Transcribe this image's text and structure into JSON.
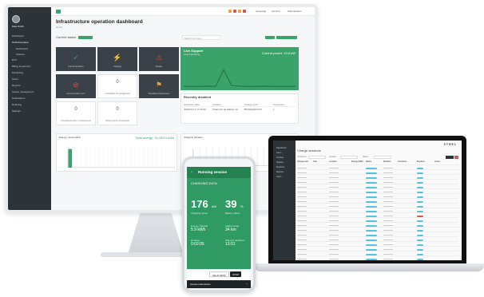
{
  "monitor": {
    "user_name": "Kate Smith",
    "sidebar": [
      {
        "label": "Dashboard",
        "active": false
      },
      {
        "label": "Technical plans",
        "active": true
      },
      {
        "label": "Dashboard",
        "sub": true
      },
      {
        "label": "Stations",
        "sub": true
      },
      {
        "label": "EVC",
        "active": false
      },
      {
        "label": "Billing & payment",
        "active": false
      },
      {
        "label": "Monitoring",
        "active": false
      },
      {
        "label": "Users",
        "active": false
      },
      {
        "label": "Reports",
        "active": false
      },
      {
        "label": "Assets management",
        "active": false
      },
      {
        "label": "Notifications",
        "active": false
      },
      {
        "label": "Roaming",
        "active": false
      },
      {
        "label": "Settings",
        "active": false
      }
    ],
    "topbar": {
      "language": "Language",
      "account": "Account",
      "role": "Administrator"
    },
    "title": "Infrastructure operation dashboard",
    "breadcrumb": "Home",
    "current_status_label": "Current status",
    "search_placeholder": "Search by name",
    "live_section_title": "Live Support",
    "live_subtitle": "Live monitoring",
    "live_value": "Current power: 13.8 kW",
    "recently_disabled_title": "Recently disabled",
    "table_headers": [
      "Activation date",
      "Location",
      "Charge point",
      "Connector"
    ],
    "table_row": [
      "2019-03-17 17:09:40",
      "Charmont de Mabrie inc",
      "BCG0Q1HS7C3",
      "1"
    ],
    "tiles": [
      {
        "label": "Normal operation",
        "icon": "check-icon",
        "dark": true,
        "num": ""
      },
      {
        "label": "Charging",
        "icon": "bolt-icon",
        "dark": true,
        "num": ""
      },
      {
        "label": "Faulted",
        "icon": "warning-icon",
        "dark": true,
        "num": ""
      },
      {
        "label": "Communication error",
        "icon": "no-signal-icon",
        "dark": true,
        "num": ""
      },
      {
        "label": "Unavailable for management",
        "icon": "",
        "dark": false,
        "num": "0"
      },
      {
        "label": "Scheduled maintenance",
        "icon": "flag-icon",
        "dark": true,
        "num": ""
      },
      {
        "label": "Unregistered cars in management",
        "icon": "",
        "dark": false,
        "num": "0"
      },
      {
        "label": "Charge points unregistered",
        "icon": "",
        "dark": false,
        "num": "0"
      }
    ],
    "energy_title": "Energy consumption",
    "energy_total": "Total energy: 15,439.4 kWh",
    "charging_title": "Charging duration",
    "charging_total": "Total"
  },
  "laptop": {
    "logo": "ETREL",
    "sidebar": [
      "Dashboard",
      "Users",
      "Invoices",
      "Stations",
      "Sessions",
      "Reports",
      "Users"
    ],
    "title": "Charge sessions",
    "filter_labels": [
      "Contractor",
      "Location",
      "Status"
    ],
    "button_labels": [
      "Export",
      "Filter"
    ],
    "headers": [
      "Charge point",
      "User",
      "Location",
      "Energy (kWh)",
      "Status",
      "Duration",
      "Connector",
      "Payment",
      "Action"
    ]
  },
  "phone": {
    "header": "Running session",
    "status_label": "CHARGING DATA",
    "power_value": "176",
    "power_unit": "kW",
    "power_label": "Charging power",
    "battery_value": "39",
    "battery_unit": "%",
    "battery_label": "Battery status",
    "energy_label": "Energy charged",
    "energy_value": "5.9 kWh",
    "range_label": "Added range",
    "range_value": "34 km",
    "duration_label": "Duration",
    "duration_value": "0:02:05",
    "end_label": "Planned departure",
    "end_value": "13:01",
    "help_label": "HELP DESK",
    "stop_label": "STOP",
    "access_label": "Access instructions"
  },
  "colors": {
    "green": "#3aa36a",
    "dark": "#2e3338",
    "orange": "#e8a33a",
    "red": "#d9534f"
  },
  "chart_data": [
    {
      "type": "bar",
      "title": "Energy consumption",
      "categories": [
        "1",
        "2",
        "3",
        "4",
        "5",
        "6",
        "7",
        "8",
        "9",
        "10",
        "11",
        "12",
        "13",
        "14",
        "15",
        "16",
        "17",
        "18",
        "19",
        "20",
        "21",
        "22",
        "23",
        "24"
      ],
      "values": [
        0.9,
        0.05,
        0.05,
        0.05,
        0.05,
        0.05,
        0.05,
        0.05,
        0.05,
        0.05,
        0.05,
        0.05,
        0.05,
        0.05,
        0.05,
        0.05,
        0.05,
        0.05,
        0.05,
        0.05,
        0.05,
        0.05,
        0.05,
        0.05
      ],
      "ylim": [
        0,
        1
      ]
    },
    {
      "type": "line",
      "title": "Live Support",
      "x": [
        0,
        1,
        2,
        3,
        4,
        5,
        6,
        7,
        8,
        9,
        10,
        11,
        12,
        13,
        14
      ],
      "values": [
        0.02,
        0.02,
        0.02,
        0.03,
        0.02,
        0.6,
        0.05,
        0.03,
        0.02,
        0.02,
        0.03,
        0.02,
        0.02,
        0.02,
        0.02
      ],
      "ylim": [
        0,
        1
      ]
    }
  ]
}
